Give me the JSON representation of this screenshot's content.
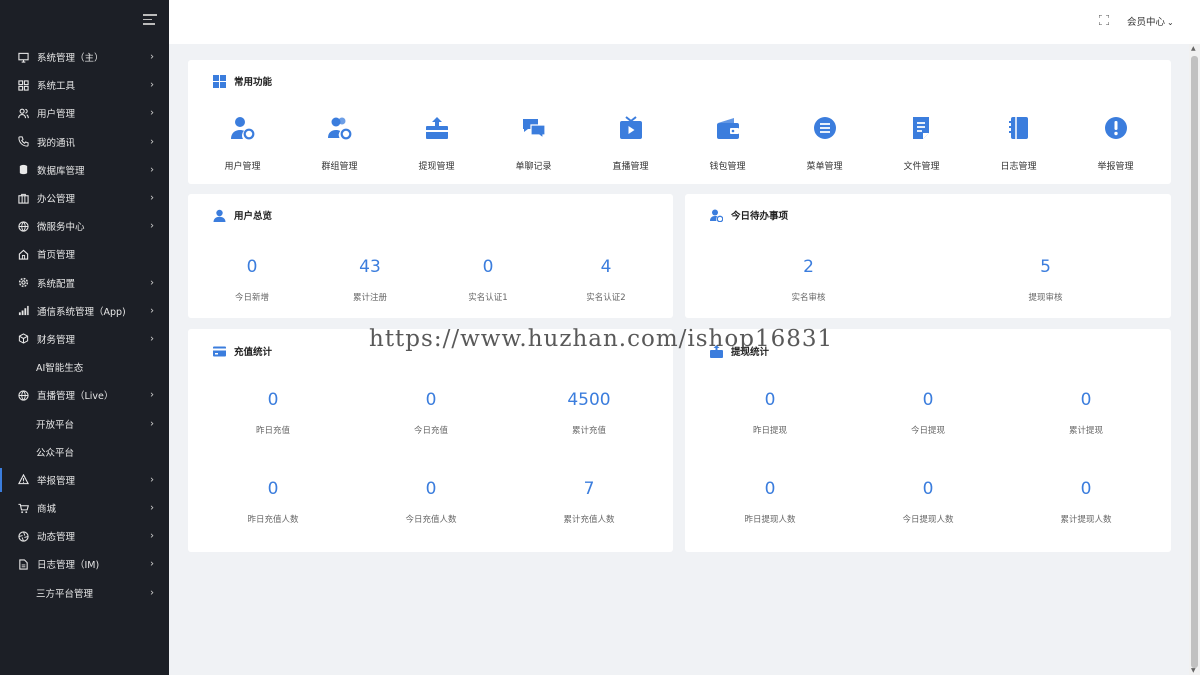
{
  "sidebar": {
    "items": [
      {
        "label": "系统管理（主）",
        "icon": "monitor-icon",
        "arrow": true
      },
      {
        "label": "系统工具",
        "icon": "grid-icon",
        "arrow": true
      },
      {
        "label": "用户管理",
        "icon": "users-icon",
        "arrow": true
      },
      {
        "label": "我的通讯",
        "icon": "phone-icon",
        "arrow": true
      },
      {
        "label": "数据库管理",
        "icon": "database-icon",
        "arrow": true
      },
      {
        "label": "办公管理",
        "icon": "office-icon",
        "arrow": true
      },
      {
        "label": "微服务中心",
        "icon": "globe-icon",
        "arrow": true
      },
      {
        "label": "首页管理",
        "icon": "home-icon",
        "arrow": false
      },
      {
        "label": "系统配置",
        "icon": "gear-icon",
        "arrow": true
      },
      {
        "label": "通信系统管理（App)",
        "icon": "signal-icon",
        "arrow": true
      },
      {
        "label": "财务管理",
        "icon": "cube-icon",
        "arrow": true
      },
      {
        "label": "AI智能生态",
        "icon": "",
        "arrow": false
      },
      {
        "label": "直播管理（Live）",
        "icon": "globe-icon",
        "arrow": true
      },
      {
        "label": "开放平台",
        "icon": "",
        "arrow": true
      },
      {
        "label": "公众平台",
        "icon": "",
        "arrow": false
      },
      {
        "label": "举报管理",
        "icon": "warning-icon",
        "arrow": true
      },
      {
        "label": "商城",
        "icon": "cart-icon",
        "arrow": true
      },
      {
        "label": "动态管理",
        "icon": "aperture-icon",
        "arrow": true
      },
      {
        "label": "日志管理（IM)",
        "icon": "file-icon",
        "arrow": true
      },
      {
        "label": "三方平台管理",
        "icon": "",
        "arrow": true
      }
    ]
  },
  "topbar": {
    "member_label": "会员中心"
  },
  "quick": {
    "title": "常用功能",
    "items": [
      {
        "label": "用户管理",
        "icon": "user-gear-icon"
      },
      {
        "label": "群组管理",
        "icon": "group-gear-icon"
      },
      {
        "label": "提现管理",
        "icon": "withdraw-icon"
      },
      {
        "label": "单聊记录",
        "icon": "chat-icon"
      },
      {
        "label": "直播管理",
        "icon": "tv-icon"
      },
      {
        "label": "钱包管理",
        "icon": "wallet-icon"
      },
      {
        "label": "菜单管理",
        "icon": "menu-icon"
      },
      {
        "label": "文件管理",
        "icon": "document-icon"
      },
      {
        "label": "日志管理",
        "icon": "notebook-icon"
      },
      {
        "label": "举报管理",
        "icon": "alert-icon"
      }
    ]
  },
  "user_overview": {
    "title": "用户总览",
    "stats": [
      {
        "value": "0",
        "label": "今日新增"
      },
      {
        "value": "43",
        "label": "累计注册"
      },
      {
        "value": "0",
        "label": "实名认证1"
      },
      {
        "value": "4",
        "label": "实名认证2"
      }
    ]
  },
  "todo": {
    "title": "今日待办事项",
    "stats": [
      {
        "value": "2",
        "label": "实名审核"
      },
      {
        "value": "5",
        "label": "提现审核"
      }
    ]
  },
  "recharge": {
    "title": "充值统计",
    "row1": [
      {
        "value": "0",
        "label": "昨日充值"
      },
      {
        "value": "0",
        "label": "今日充值"
      },
      {
        "value": "4500",
        "label": "累计充值"
      }
    ],
    "row2": [
      {
        "value": "0",
        "label": "昨日充值人数"
      },
      {
        "value": "0",
        "label": "今日充值人数"
      },
      {
        "value": "7",
        "label": "累计充值人数"
      }
    ]
  },
  "withdraw": {
    "title": "提现统计",
    "row1": [
      {
        "value": "0",
        "label": "昨日提现"
      },
      {
        "value": "0",
        "label": "今日提现"
      },
      {
        "value": "0",
        "label": "累计提现"
      }
    ],
    "row2": [
      {
        "value": "0",
        "label": "昨日提现人数"
      },
      {
        "value": "0",
        "label": "今日提现人数"
      },
      {
        "value": "0",
        "label": "累计提现人数"
      }
    ]
  },
  "watermark": "https://www.huzhan.com/ishop16831",
  "colors": {
    "accent": "#3b7ddd",
    "sidebar_bg": "#1c1f26",
    "page_bg": "#f0f2f5"
  }
}
